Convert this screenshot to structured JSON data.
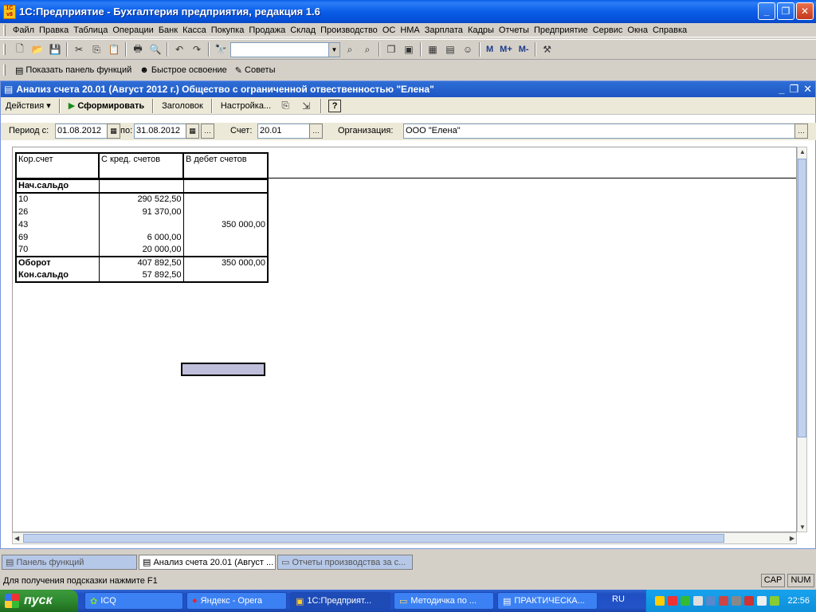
{
  "window": {
    "title": "1С:Предприятие - Бухгалтерия предприятия, редакция 1.6",
    "logo": "1С v8"
  },
  "menu": [
    "Файл",
    "Правка",
    "Таблица",
    "Операции",
    "Банк",
    "Касса",
    "Покупка",
    "Продажа",
    "Склад",
    "Производство",
    "ОС",
    "НМА",
    "Зарплата",
    "Кадры",
    "Отчеты",
    "Предприятие",
    "Сервис",
    "Окна",
    "Справка"
  ],
  "toolbar": {
    "m": "M",
    "mplus": "M+",
    "mminus": "M-"
  },
  "toolbar2": {
    "show_panel": "Показать панель функций",
    "quick_learn": "Быстрое освоение",
    "tips": "Советы"
  },
  "doc": {
    "title": "Анализ счета 20.01 (Август 2012 г.) Общество с ограниченной отвественностью \"Елена\"",
    "actions": "Действия",
    "generate": "Сформировать",
    "header_btn": "Заголовок",
    "settings": "Настройка..."
  },
  "form": {
    "period_from_label": "Период с:",
    "period_from": "01.08.2012",
    "period_to_label": "по:",
    "period_to": "31.08.2012",
    "account_label": "Счет:",
    "account": "20.01",
    "org_label": "Организация:",
    "org": "ООО \"Елена\""
  },
  "report": {
    "headers": [
      "Кор.счет",
      "С кред. счетов",
      "В дебет счетов"
    ],
    "start_balance": "Нач.сальдо",
    "rows": [
      {
        "acc": "10",
        "credit": "290 522,50",
        "debit": ""
      },
      {
        "acc": "26",
        "credit": "91 370,00",
        "debit": ""
      },
      {
        "acc": "43",
        "credit": "",
        "debit": "350 000,00"
      },
      {
        "acc": "69",
        "credit": "6 000,00",
        "debit": ""
      },
      {
        "acc": "70",
        "credit": "20 000,00",
        "debit": ""
      }
    ],
    "turnover_label": "Оборот",
    "turnover_credit": "407 892,50",
    "turnover_debit": "350 000,00",
    "end_balance_label": "Кон.сальдо",
    "end_balance": "57 892,50"
  },
  "tabs": [
    "Панель функций",
    "Анализ счета 20.01 (Август ...",
    "Отчеты производства за с..."
  ],
  "status": {
    "hint": "Для получения подсказки нажмите F1",
    "cap": "CAP",
    "num": "NUM"
  },
  "taskbar": {
    "start": "пуск",
    "tasks": [
      "ICQ",
      "Яндекс - Opera",
      "1С:Предприят...",
      "Методичка по ...",
      "ПРАКТИЧЕСКА..."
    ],
    "lang": "RU",
    "clock": "22:56"
  }
}
